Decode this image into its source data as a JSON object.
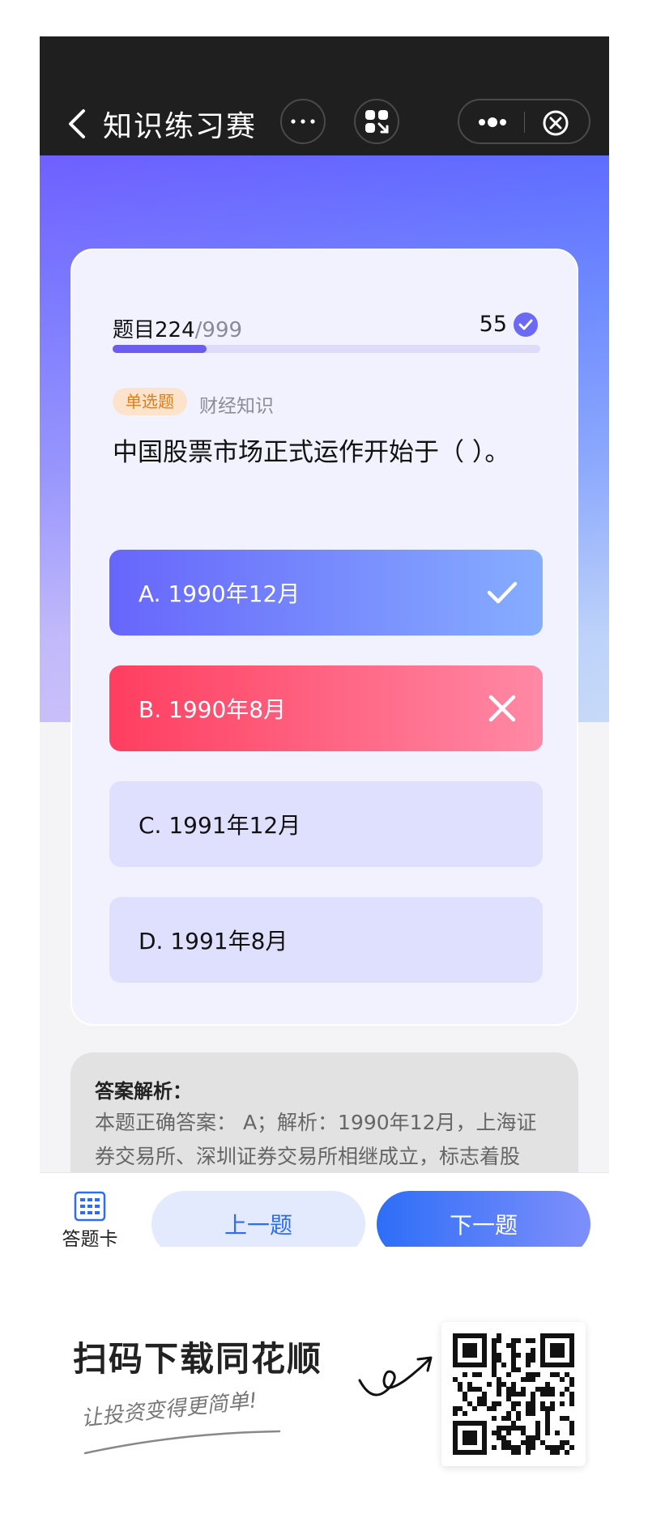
{
  "header": {
    "title": "知识练习赛"
  },
  "progress": {
    "label": "题目224",
    "total": "/999",
    "fraction": 0.22,
    "score": "55"
  },
  "question": {
    "type_tag": "单选题",
    "category": "财经知识",
    "text": "中国股票市场正式运作开始于（ ）。"
  },
  "options": [
    {
      "label": "A. 1990年12月",
      "state": "correct"
    },
    {
      "label": "B. 1990年8月",
      "state": "wrong"
    },
    {
      "label": "C. 1991年12月",
      "state": "plain"
    },
    {
      "label": "D. 1991年8月",
      "state": "plain"
    }
  ],
  "analysis": {
    "title": "答案解析：",
    "body": "本题正确答案： A；解析：1990年12月，上海证券交易所、深圳证券交易所相继成立，标志着股"
  },
  "bottom_bar": {
    "answer_card_label": "答题卡",
    "prev_label": "上一题",
    "next_label": "下一题"
  },
  "promo": {
    "title": "扫码下载同花顺",
    "subtitle": "让投资变得更简单!"
  },
  "colors": {
    "accent": "#6c5cf0",
    "correct": "#6766fb",
    "wrong": "#ff3e60",
    "primary_button": "#2d6ef7"
  },
  "icons": [
    "back-icon",
    "more-icon",
    "grid-icon",
    "dots-icon",
    "close-icon",
    "check-icon",
    "x-icon",
    "answer-card-icon",
    "arrow-doodle-icon"
  ]
}
